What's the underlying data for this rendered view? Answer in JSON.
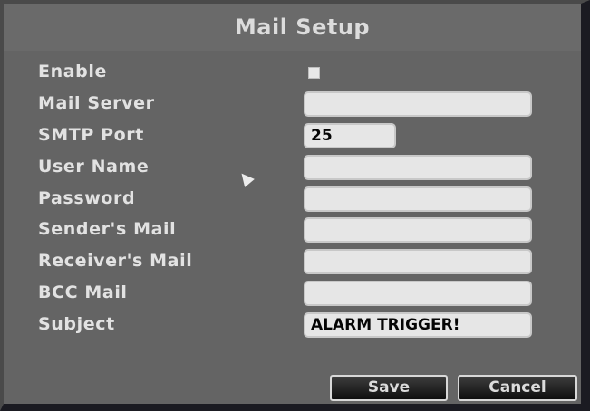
{
  "window": {
    "title": "Mail Setup"
  },
  "form": {
    "enable": {
      "label": "Enable",
      "checked": true
    },
    "mail_server": {
      "label": "Mail Server",
      "value": ""
    },
    "smtp_port": {
      "label": "SMTP Port",
      "value": "25"
    },
    "user_name": {
      "label": "User Name",
      "value": ""
    },
    "password": {
      "label": "Password",
      "value": ""
    },
    "senders_mail": {
      "label": "Sender's Mail",
      "value": ""
    },
    "receivers_mail": {
      "label": "Receiver's Mail",
      "value": ""
    },
    "bcc_mail": {
      "label": "BCC Mail",
      "value": ""
    },
    "subject": {
      "label": "Subject",
      "value": "ALARM TRIGGER!"
    }
  },
  "buttons": {
    "save_label": "Save",
    "cancel_label": "Cancel"
  }
}
